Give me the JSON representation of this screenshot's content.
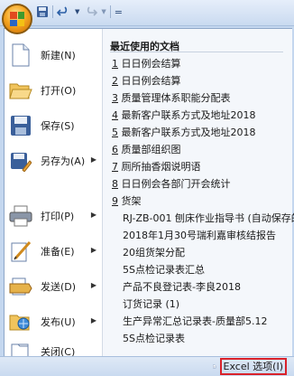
{
  "quick_access": {
    "separator": "="
  },
  "left_menu": [
    {
      "label": "新建(N)",
      "has_submenu": false,
      "icon": "new-document-icon"
    },
    {
      "label": "打开(O)",
      "has_submenu": false,
      "icon": "open-folder-icon"
    },
    {
      "label": "保存(S)",
      "has_submenu": false,
      "icon": "save-icon"
    },
    {
      "label": "另存为(A)",
      "has_submenu": true,
      "icon": "save-as-icon"
    },
    {
      "label": "打印(P)",
      "has_submenu": true,
      "icon": "printer-icon"
    },
    {
      "label": "准备(E)",
      "has_submenu": true,
      "icon": "prepare-icon"
    },
    {
      "label": "发送(D)",
      "has_submenu": true,
      "icon": "send-icon"
    },
    {
      "label": "发布(U)",
      "has_submenu": true,
      "icon": "publish-icon"
    },
    {
      "label": "关闭(C)",
      "has_submenu": false,
      "icon": "close-folder-icon"
    }
  ],
  "recent": {
    "title": "最近使用的文档",
    "items": [
      {
        "num": "1",
        "name": "日日例会结算"
      },
      {
        "num": "2",
        "name": "日日例会结算"
      },
      {
        "num": "3",
        "name": "质量管理体系职能分配表"
      },
      {
        "num": "4",
        "name": "最新客户联系方式及地址2018"
      },
      {
        "num": "5",
        "name": "最新客户联系方式及地址2018"
      },
      {
        "num": "6",
        "name": "质量部组织图"
      },
      {
        "num": "7",
        "name": "厕所抽香烟说明语"
      },
      {
        "num": "8",
        "name": "日日例会各部门开会统计"
      },
      {
        "num": "9",
        "name": "货架"
      },
      {
        "num": "",
        "name": "RJ-ZB-001 刨床作业指导书 (自动保存的"
      },
      {
        "num": "",
        "name": "2018年1月30号瑞利嘉审核结报告"
      },
      {
        "num": "",
        "name": "20组货架分配"
      },
      {
        "num": "",
        "name": "5S点检记录表汇总"
      },
      {
        "num": "",
        "name": "产品不良登记表-李良2018"
      },
      {
        "num": "",
        "name": "订货记录 (1)"
      },
      {
        "num": "",
        "name": "生产异常汇总记录表-质量部5.12"
      },
      {
        "num": "",
        "name": "5S点检记录表"
      }
    ]
  },
  "bottom": {
    "options_label": "Excel 选项(I)"
  },
  "colors": {
    "accent_red": "#d9222a",
    "menu_border": "#8ea7c8",
    "ribbon_blue": "#c4d7ef"
  }
}
